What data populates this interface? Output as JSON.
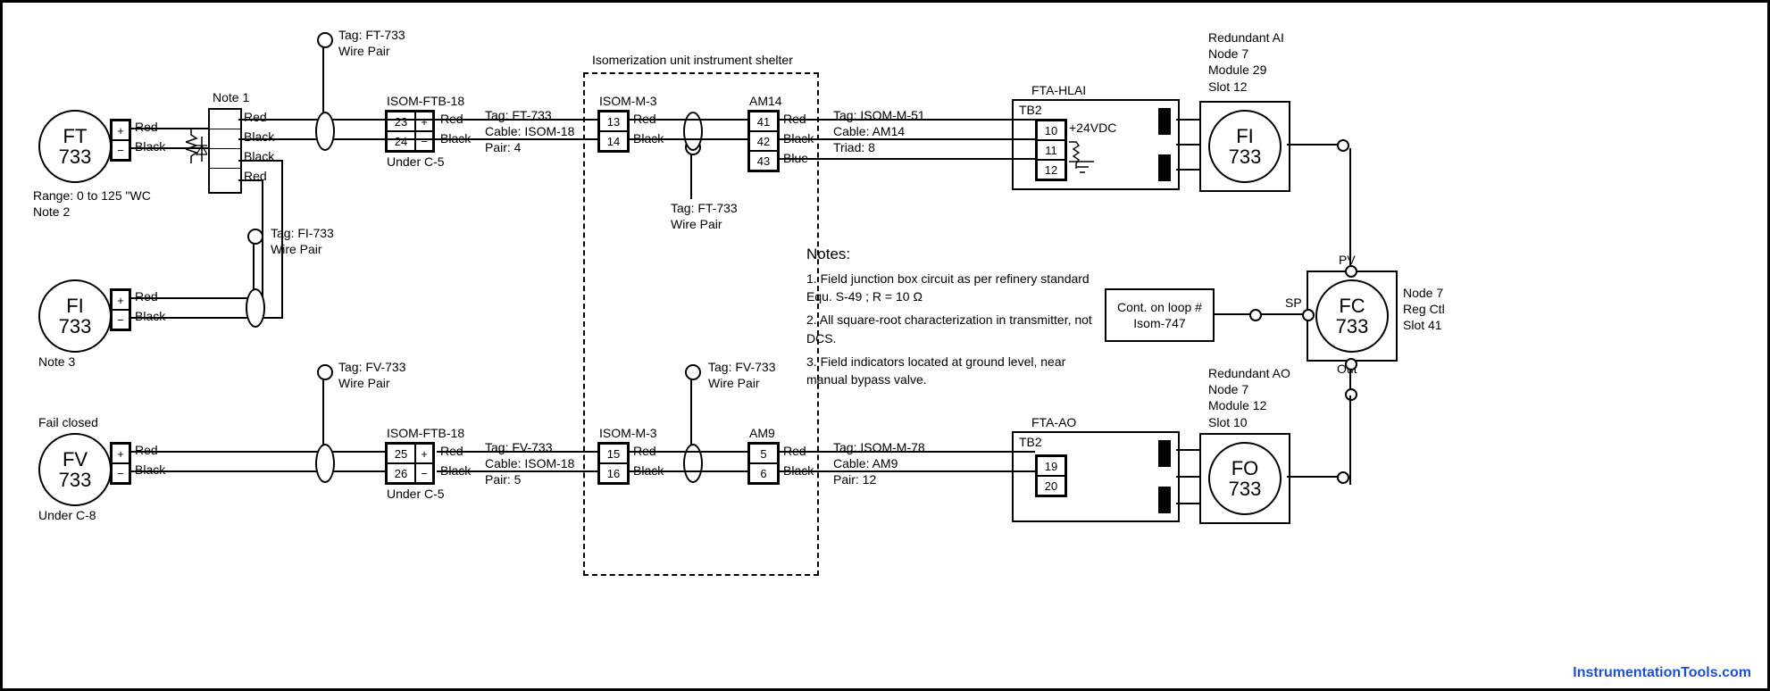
{
  "instruments": {
    "ft733": {
      "tag": "FT",
      "num": "733",
      "range": "Range: 0 to 125 \"WC",
      "note": "Note 2"
    },
    "fi733_field": {
      "tag": "FI",
      "num": "733",
      "note": "Note 3"
    },
    "fv733": {
      "tag": "FV",
      "num": "733",
      "fail": "Fail closed",
      "loc": "Under C-8"
    },
    "fi733_dcs": {
      "tag": "FI",
      "num": "733",
      "desc1": "Redundant AI",
      "desc2": "Node 7",
      "desc3": "Module 29",
      "desc4": "Slot 12"
    },
    "fc733": {
      "tag": "FC",
      "num": "733",
      "desc1": "Node 7",
      "desc2": "Reg Ctl",
      "desc3": "Slot 41"
    },
    "fo733": {
      "tag": "FO",
      "num": "733",
      "desc1": "Redundant AO",
      "desc2": "Node 7",
      "desc3": "Module 12",
      "desc4": "Slot 10"
    }
  },
  "wires": {
    "red": "Red",
    "black": "Black",
    "blue": "Blue"
  },
  "shelter_title": "Isomerization unit instrument shelter",
  "note1_label": "Note 1",
  "ftb": {
    "name": "ISOM-FTB-18",
    "loc": "Under C-5",
    "t23": "23",
    "t24": "24",
    "t25": "25",
    "t26": "26"
  },
  "m3": {
    "name": "ISOM-M-3",
    "t13": "13",
    "t14": "14",
    "t15": "15",
    "t16": "16"
  },
  "am14": {
    "name": "AM14",
    "t41": "41",
    "t42": "42",
    "t43": "43"
  },
  "am9": {
    "name": "AM9",
    "t5": "5",
    "t6": "6"
  },
  "fta_hlai": {
    "name": "FTA-HLAI",
    "tb": "TB2",
    "t10": "10",
    "t11": "11",
    "t12": "12",
    "v": "+24VDC"
  },
  "fta_ao": {
    "name": "FTA-AO",
    "tb": "TB2",
    "t19": "19",
    "t20": "20"
  },
  "cables": {
    "up1": {
      "tag": "Tag: FT-733",
      "cable": "Cable: ISOM-18",
      "pair": "Pair: 4"
    },
    "up2": {
      "tag": "Tag: ISOM-M-51",
      "cable": "Cable: AM14",
      "triad": "Triad: 8"
    },
    "dn1": {
      "tag": "Tag: FV-733",
      "cable": "Cable: ISOM-18",
      "pair": "Pair: 5"
    },
    "dn2": {
      "tag": "Tag: ISOM-M-78",
      "cable": "Cable: AM9",
      "pair": "Pair: 12"
    }
  },
  "flags": {
    "ft733": {
      "a": "Tag: FT-733",
      "b": "Wire Pair"
    },
    "fi733": {
      "a": "Tag: FI-733",
      "b": "Wire Pair"
    },
    "fv733": {
      "a": "Tag: FV-733",
      "b": "Wire Pair"
    }
  },
  "notes": {
    "title": "Notes:",
    "n1": "1. Field junction box circuit as per refinery standard Equ. S-49 ; R = 10 Ω",
    "n2": "2. All square-root characterization in transmitter, not DCS.",
    "n3": "3. Field indicators located at ground level, near manual bypass valve."
  },
  "cont": {
    "a": "Cont. on loop #",
    "b": "Isom-747"
  },
  "fc_ports": {
    "pv": "PV",
    "sp": "SP",
    "out": "Out"
  },
  "watermark": "InstrumentationTools.com"
}
